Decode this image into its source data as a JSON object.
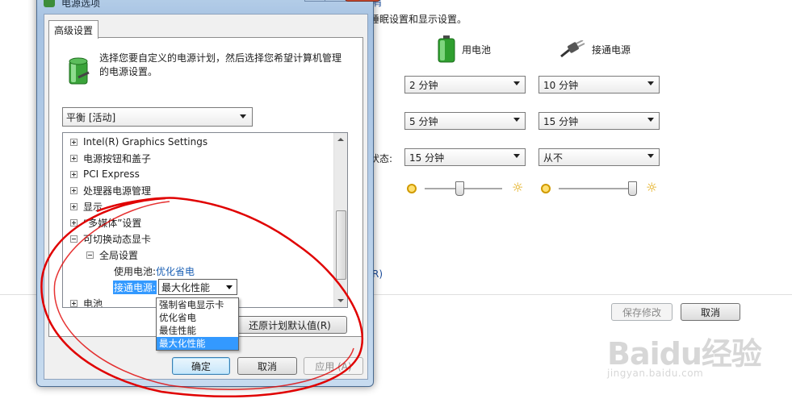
{
  "background": {
    "link_top": "肩",
    "intro_text": "睡眠设置和显示设置。",
    "battery_label": "用电池",
    "plugged_label": "接通电源",
    "rows": [
      {
        "label": "",
        "battery": "2 分钟",
        "plugged": "10 分钟"
      },
      {
        "label": "",
        "battery": "5 分钟",
        "plugged": "15 分钟"
      },
      {
        "label": "状态:",
        "battery": "15 分钟",
        "plugged": "从不"
      }
    ],
    "brightness_battery_pct": 45,
    "brightness_plugged_pct": 95,
    "link_r": "R)",
    "save_button": "保存修改",
    "cancel_button": "取消",
    "watermark_logo": "Baidu经验",
    "watermark_site": "jingyan.baidu.com"
  },
  "dialog": {
    "title": "电源选项",
    "tab_label": "高级设置",
    "intro": "选择您要自定义的电源计划，然后选择您希望计算机管理的电源设置。",
    "plan_value": "平衡 [活动]",
    "tree": [
      "Intel(R) Graphics Settings",
      "电源按钮和盖子",
      "PCI Express",
      "处理器电源管理",
      "显示",
      "“多媒体”设置",
      "可切换动态显卡",
      "全局设置",
      "使用电池:",
      "优化省电",
      "接通电源:",
      "最大化性能",
      "电池"
    ],
    "dropdown_options": [
      "强制省电显示卡",
      "优化省电",
      "最佳性能",
      "最大化性能"
    ],
    "restore_button": "还原计划默认值(R)",
    "ok_button": "确定",
    "cancel_button": "取消",
    "apply_button": "应用 (A)"
  },
  "colors": {
    "selection": "#3399ff",
    "link": "#1a4c9c",
    "annotation_red": "#e00000"
  }
}
